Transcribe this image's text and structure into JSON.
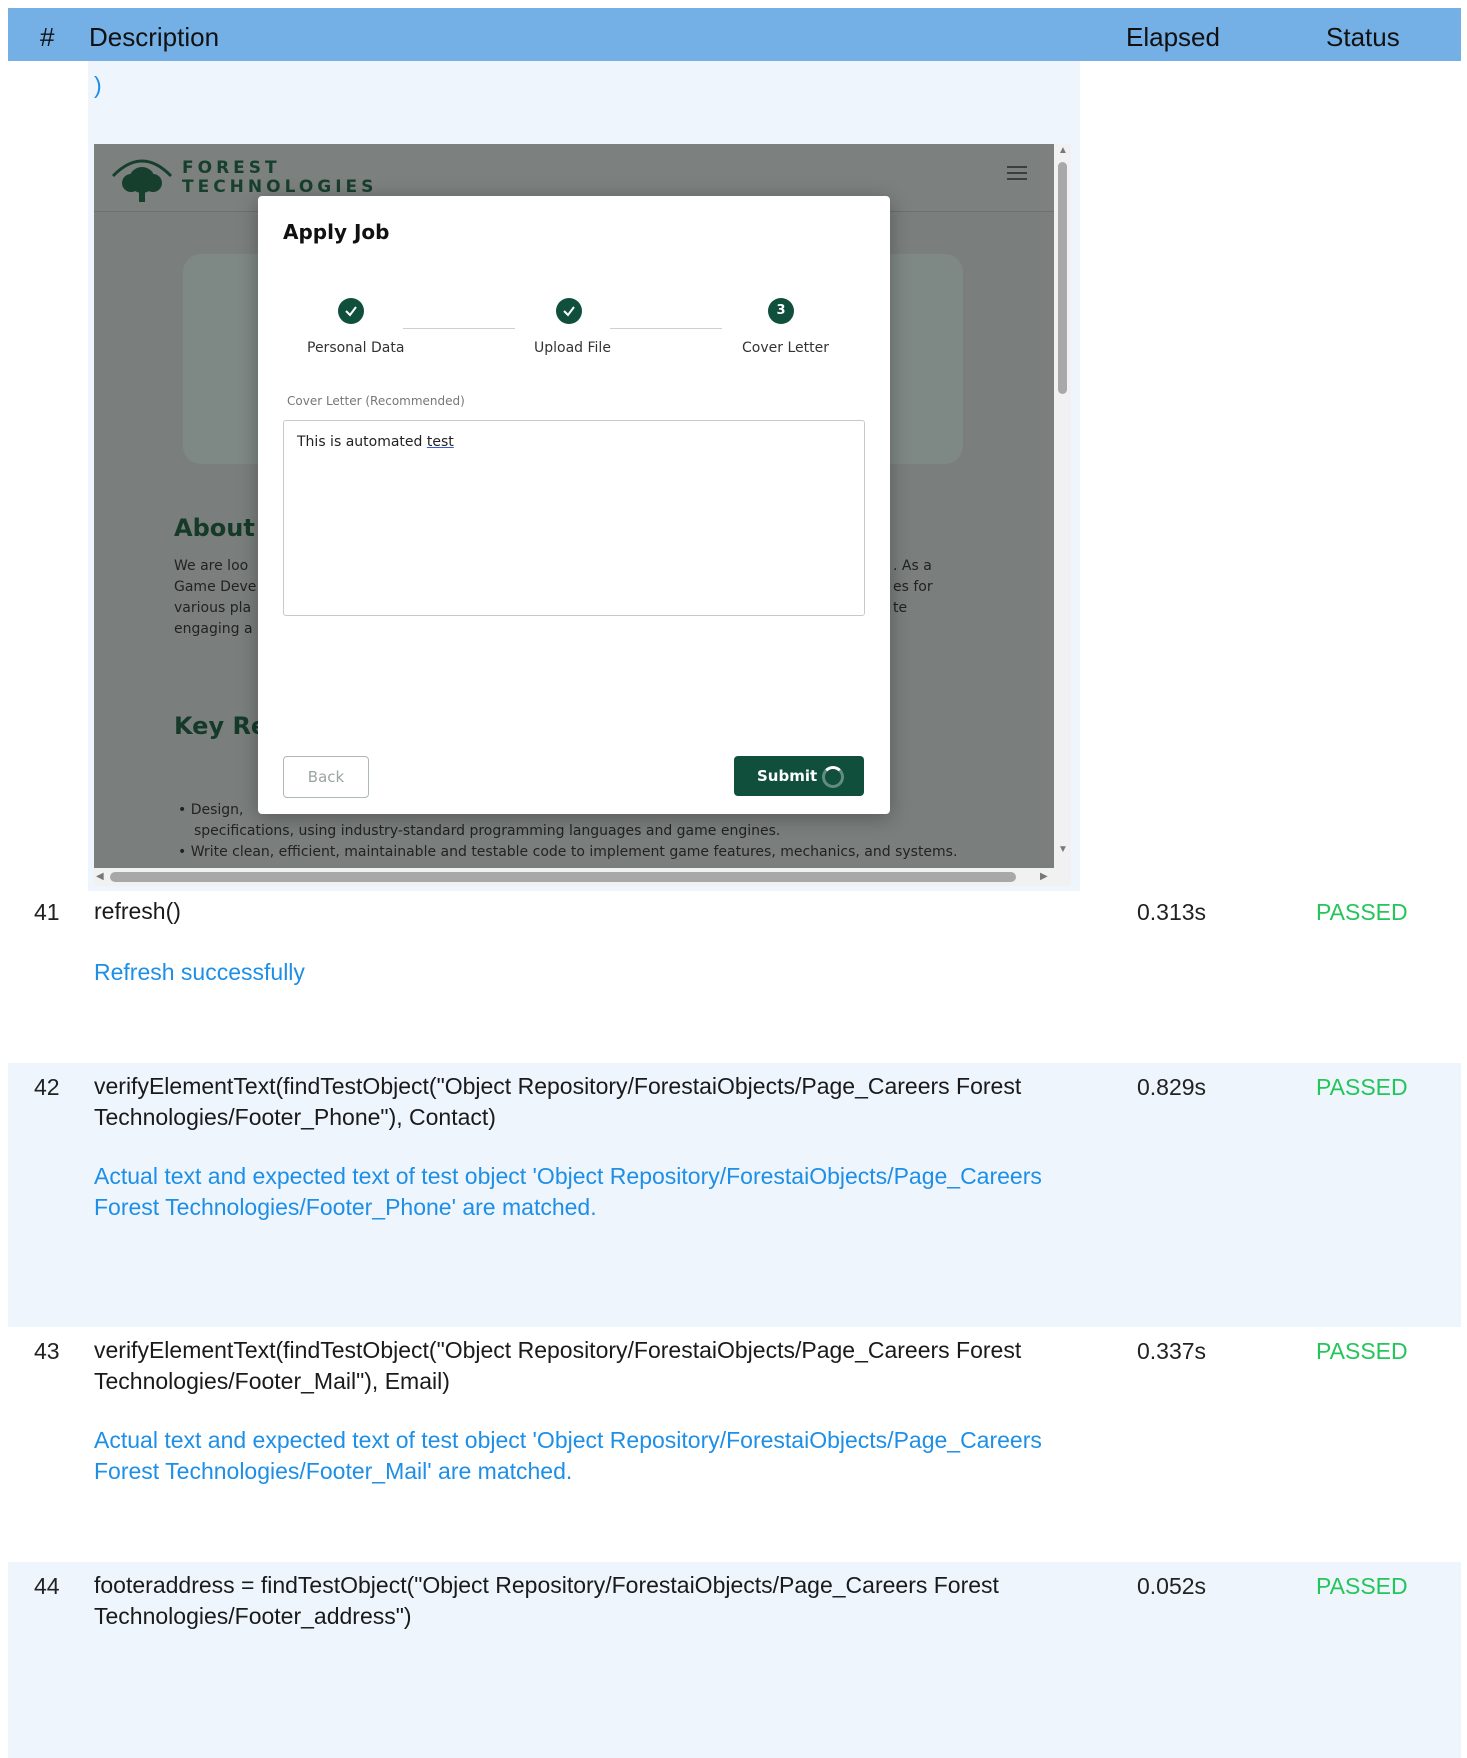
{
  "header": {
    "num": "#",
    "description": "Description",
    "elapsed": "Elapsed",
    "status": "Status"
  },
  "screenshot": {
    "caption_tail": ")",
    "site": {
      "logo_line1": "FOREST",
      "logo_line2": "TECHNOLOGIES",
      "about_heading": "About",
      "about_lines": [
        "We are loo",
        "Game Deve",
        "various pla",
        "engaging a"
      ],
      "about_right": [
        ". As a",
        "es for",
        "te"
      ],
      "key_heading": "Key Re",
      "bullets": [
        "Design,",
        "specifications, using industry-standard programming languages and game engines.",
        "Write clean, efficient, maintainable and testable code to implement game features, mechanics, and systems."
      ]
    },
    "modal": {
      "title": "Apply Job",
      "steps": [
        {
          "label": "Personal Data",
          "state": "done"
        },
        {
          "label": "Upload File",
          "state": "done"
        },
        {
          "label": "Cover Letter",
          "state": "active",
          "number": "3"
        }
      ],
      "field_label": "Cover Letter (Recommended)",
      "textarea_value_a": "This is automated ",
      "textarea_value_b": "test",
      "back_label": "Back",
      "submit_label": "Submit"
    }
  },
  "rows": [
    {
      "num": "41",
      "description": "refresh()",
      "message": "Refresh successfully",
      "elapsed": "0.313s",
      "status": "PASSED"
    },
    {
      "num": "42",
      "description": "verifyElementText(findTestObject(\"Object Repository/ForestaiObjects/Page_Careers  Forest Technologies/Footer_Phone\"), Contact)",
      "message": "Actual text and expected text of test object 'Object Repository/ForestaiObjects/Page_Careers  Forest Technologies/Footer_Phone' are matched.",
      "elapsed": "0.829s",
      "status": "PASSED"
    },
    {
      "num": "43",
      "description": "verifyElementText(findTestObject(\"Object Repository/ForestaiObjects/Page_Careers  Forest Technologies/Footer_Mail\"), Email)",
      "message": "Actual text and expected text of test object 'Object Repository/ForestaiObjects/Page_Careers  Forest Technologies/Footer_Mail' are matched.",
      "elapsed": "0.337s",
      "status": "PASSED"
    },
    {
      "num": "44",
      "description": "footeraddress = findTestObject(\"Object Repository/ForestaiObjects/Page_Careers  Forest Technologies/Footer_address\")",
      "message": "",
      "elapsed": "0.052s",
      "status": "PASSED"
    }
  ],
  "colors": {
    "header": "#74b0e6",
    "row_alt": "#eef5fd",
    "message": "#1e8fe6",
    "passed": "#24c55a",
    "brand": "#0f4f3c"
  }
}
